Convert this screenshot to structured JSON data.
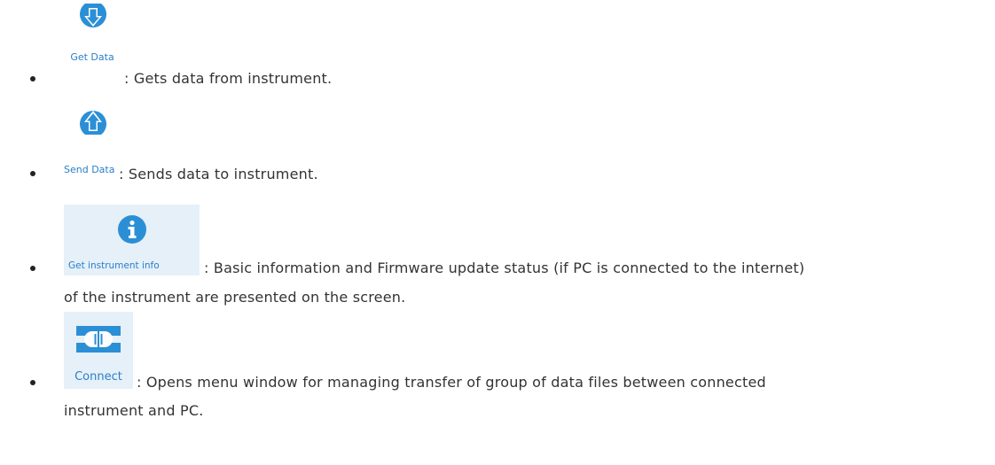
{
  "items": [
    {
      "icon": "arrow-down-circle-icon",
      "label": "Get Data",
      "colon": ":",
      "description": "Gets data from instrument."
    },
    {
      "icon": "arrow-up-circle-icon",
      "label": "Send Data",
      "colon": ":",
      "description": "Sends data to instrument."
    },
    {
      "icon": "info-circle-icon",
      "label": "Get instrument info",
      "colon": ":",
      "description": "Basic information and Firmware update status (if PC is connected to the internet)",
      "description_line2": "of the instrument are presented on the screen."
    },
    {
      "icon": "plug-connect-icon",
      "label": "Connect",
      "colon": ":",
      "description": "Opens menu window for managing transfer of group of data files between connected",
      "description_line2": "instrument and PC."
    }
  ],
  "colors": {
    "icon_blue": "#2b8fd6",
    "label_blue": "#2a7fc9",
    "button_bg": "#e6f0f8",
    "text": "#333333"
  }
}
